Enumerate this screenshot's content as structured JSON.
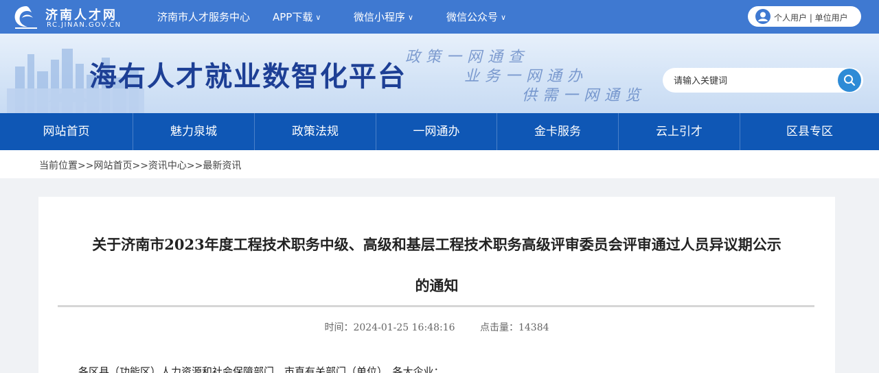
{
  "topbar": {
    "logo_title": "济南人才网",
    "logo_subtitle": "RC.JINAN.GOV.CN",
    "nav": [
      {
        "label": "济南市人才服务中心",
        "has_dropdown": false
      },
      {
        "label": "APP下载",
        "has_dropdown": true
      },
      {
        "label": "微信小程序",
        "has_dropdown": true
      },
      {
        "label": "微信公众号",
        "has_dropdown": true
      }
    ],
    "user_links": "个人用户 | 单位用户"
  },
  "banner": {
    "title": "海右人才就业数智化平台",
    "slogans": [
      "政策一网通查",
      "业务一网通办",
      "供需一网通览"
    ],
    "search_placeholder": "请输入关键词"
  },
  "main_nav": [
    "网站首页",
    "魅力泉城",
    "政策法规",
    "一网通办",
    "金卡服务",
    "云上引才",
    "区县专区"
  ],
  "breadcrumb": "当前位置>>网站首页>>资讯中心>>最新资讯",
  "article": {
    "title_line1": "关于济南市2023年度工程技术职务中级、高级和基层工程技术职务高级评审委员会评审通过人员异议期公示",
    "title_line2": "的通知",
    "time_label": "时间：",
    "time": "2024-01-25 16:48:16",
    "views_label": "点击量：",
    "views": "14384",
    "body_first_line": "各区县（功能区）人力资源和社会保障部门、市直有关部门（单位）、各大企业："
  },
  "colors": {
    "topbar": "#3f79d1",
    "main_nav": "#0f57b5",
    "banner_title": "#1d3f95",
    "search_button": "#2e8bd6"
  }
}
